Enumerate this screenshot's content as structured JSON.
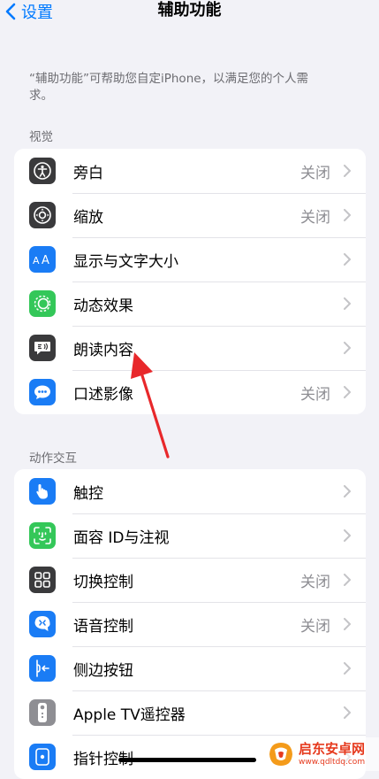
{
  "nav": {
    "back_label": "设置",
    "title": "辅助功能"
  },
  "intro_text": "“辅助功能”可帮助您自定iPhone，以满足您的个人需求。",
  "sections": {
    "vision": {
      "header": "视觉",
      "rows": [
        {
          "label": "旁白",
          "value": "关闭",
          "icon": "voiceover-icon",
          "color": "#3a3a3c"
        },
        {
          "label": "缩放",
          "value": "关闭",
          "icon": "zoom-icon",
          "color": "#3a3a3c"
        },
        {
          "label": "显示与文字大小",
          "value": "",
          "icon": "text-size-icon",
          "color": "#1a7cf5"
        },
        {
          "label": "动态效果",
          "value": "",
          "icon": "motion-icon",
          "color": "#34c759"
        },
        {
          "label": "朗读内容",
          "value": "",
          "icon": "spoken-content-icon",
          "color": "#3a3a3c"
        },
        {
          "label": "口述影像",
          "value": "关闭",
          "icon": "audio-description-icon",
          "color": "#1a7cf5"
        }
      ]
    },
    "interaction": {
      "header": "动作交互",
      "rows": [
        {
          "label": "触控",
          "value": "",
          "icon": "touch-icon",
          "color": "#1a7cf5"
        },
        {
          "label": "面容 ID与注视",
          "value": "",
          "icon": "face-id-icon",
          "color": "#34c759"
        },
        {
          "label": "切换控制",
          "value": "关闭",
          "icon": "switch-control-icon",
          "color": "#3a3a3c"
        },
        {
          "label": "语音控制",
          "value": "关闭",
          "icon": "voice-control-icon",
          "color": "#1a7cf5"
        },
        {
          "label": "侧边按钮",
          "value": "",
          "icon": "side-button-icon",
          "color": "#1a7cf5"
        },
        {
          "label": "Apple TV遥控器",
          "value": "",
          "icon": "apple-tv-remote-icon",
          "color": "#8e8e93"
        },
        {
          "label": "指针控制",
          "value": "",
          "icon": "pointer-control-icon",
          "color": "#1a7cf5"
        }
      ]
    }
  },
  "watermark": {
    "title": "启东安卓网",
    "url": "www.qdltdq.com"
  },
  "colors": {
    "accent": "#007aff",
    "background": "#f2f2f7",
    "annotation_arrow": "#e8282b"
  }
}
